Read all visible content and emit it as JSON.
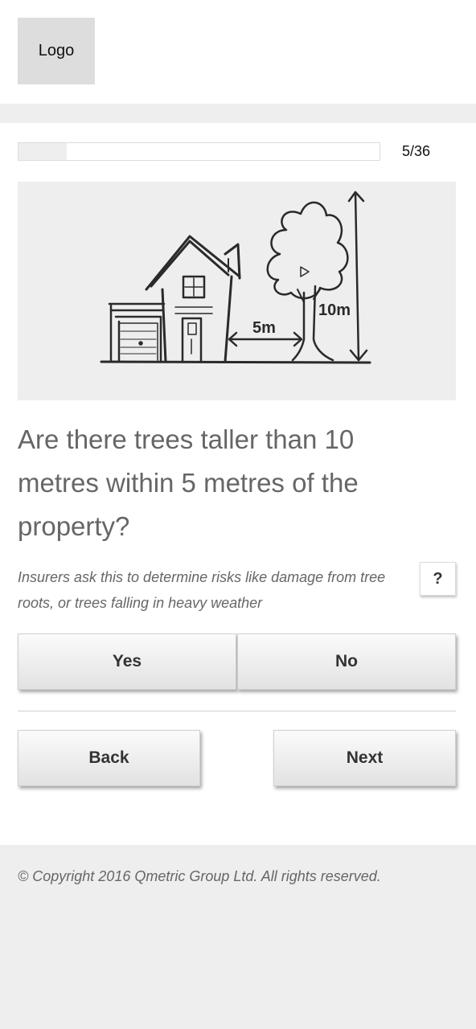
{
  "header": {
    "logo_label": "Logo"
  },
  "progress": {
    "current": 5,
    "total": 36,
    "label": "5/36",
    "fraction": 0.133
  },
  "illustration": {
    "label_distance": "5m",
    "label_height": "10m"
  },
  "question": {
    "text": "Are there trees taller than 10 metres within 5 metres of the property?",
    "hint": "Insurers ask this to determine risks like damage from tree roots, or trees falling in heavy weather",
    "help_label": "?"
  },
  "answers": {
    "yes_label": "Yes",
    "no_label": "No"
  },
  "navigation": {
    "back_label": "Back",
    "next_label": "Next"
  },
  "footer": {
    "copyright": "© Copyright 2016 Qmetric Group Ltd. All rights reserved."
  }
}
